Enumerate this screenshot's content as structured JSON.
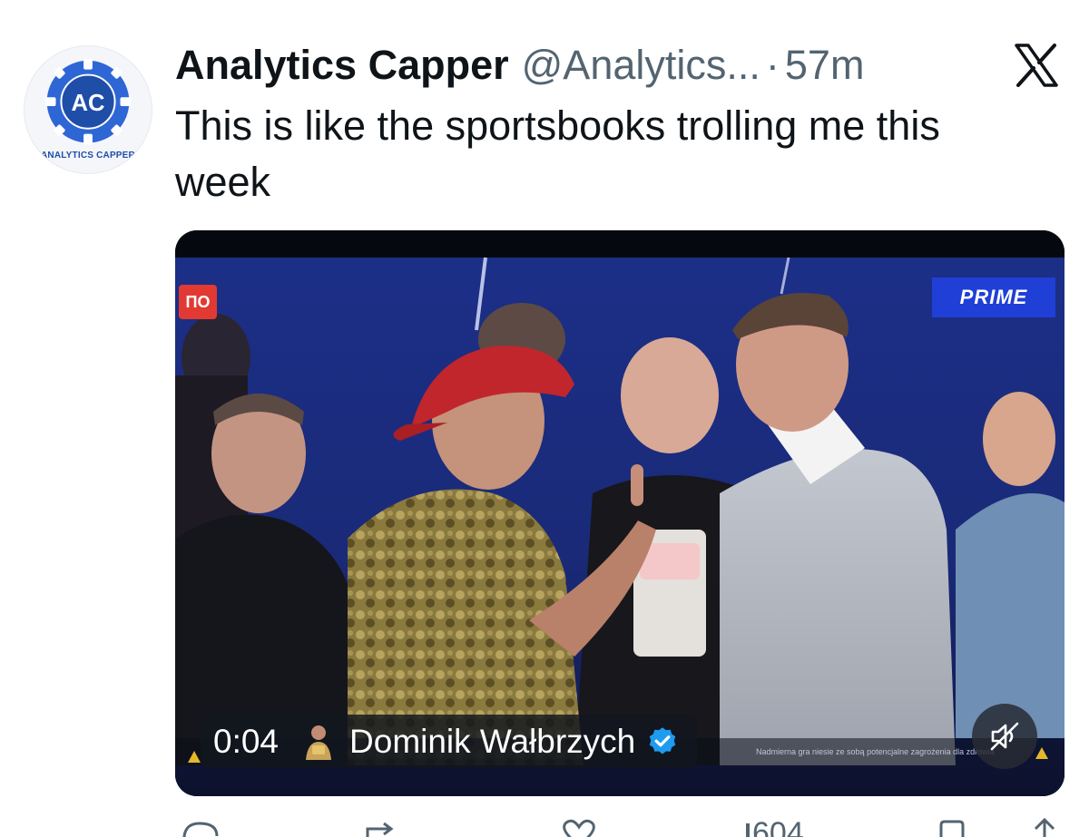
{
  "author": {
    "display_name": "Analytics Capper",
    "handle": "@Analytics...",
    "separator": "·",
    "time": "57m",
    "avatar_initials": "AC",
    "avatar_brand": "ANALYTICS CAPPER"
  },
  "tweet": {
    "text": "This is like the sportsbooks trolling me this week"
  },
  "video": {
    "channel_logo_text": "ΠO",
    "event_logo_text": "PRIME",
    "timecode": "0:04",
    "uploader_name": "Dominik Wałbrzych",
    "ticker_text": "Nadmierna gra niesie ze sobą potencjalne zagrożenia dla zdrowia"
  },
  "actions": {
    "views_count": "604"
  },
  "icons": {
    "close": "x-logo-icon",
    "verified": "verified-badge-icon",
    "mute": "muted-speaker-icon",
    "warning": "warning-icon"
  },
  "colors": {
    "brand_blue": "#1d9bf0",
    "secondary_text": "#536471",
    "prime_blue": "#1f3fd6"
  }
}
